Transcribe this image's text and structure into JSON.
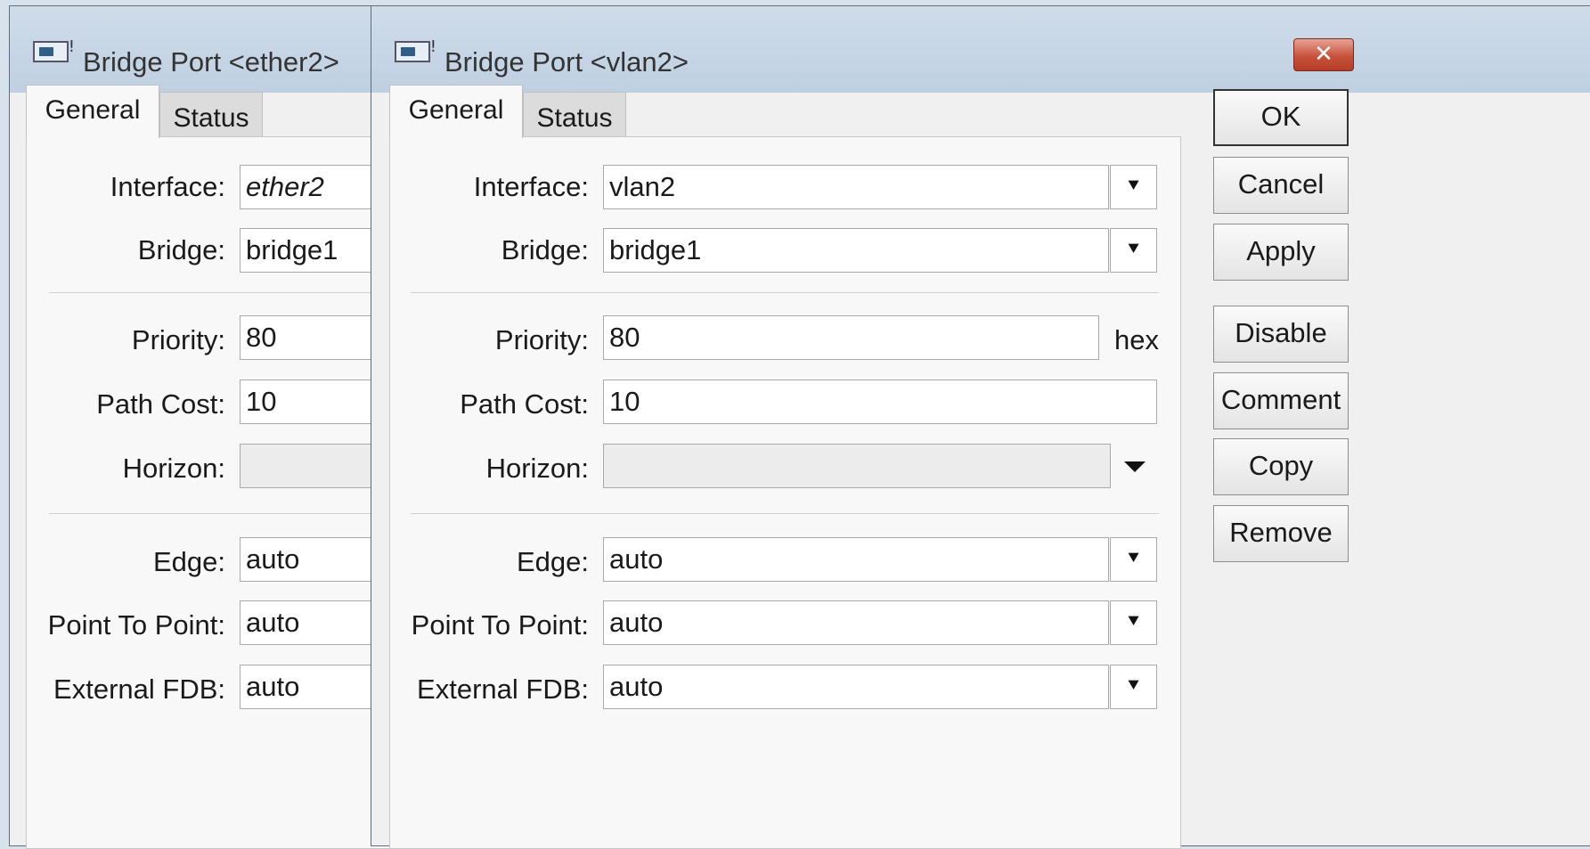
{
  "back_window": {
    "title": "Bridge Port <ether2>",
    "tabs": [
      "General",
      "Status"
    ],
    "fields": {
      "interface": {
        "label": "Interface:",
        "value": "ether2"
      },
      "bridge": {
        "label": "Bridge:",
        "value": "bridge1"
      },
      "priority": {
        "label": "Priority:",
        "value": "80"
      },
      "path_cost": {
        "label": "Path Cost:",
        "value": "10"
      },
      "horizon": {
        "label": "Horizon:",
        "value": ""
      },
      "edge": {
        "label": "Edge:",
        "value": "auto"
      },
      "point_to_point": {
        "label": "Point To Point:",
        "value": "auto"
      },
      "external_fdb": {
        "label": "External FDB:",
        "value": "auto"
      }
    }
  },
  "front_window": {
    "title": "Bridge Port <vlan2>",
    "close_glyph": "✕",
    "tabs": [
      "General",
      "Status"
    ],
    "fields": {
      "interface": {
        "label": "Interface:",
        "value": "vlan2"
      },
      "bridge": {
        "label": "Bridge:",
        "value": "bridge1"
      },
      "priority": {
        "label": "Priority:",
        "value": "80",
        "unit": "hex"
      },
      "path_cost": {
        "label": "Path Cost:",
        "value": "10"
      },
      "horizon": {
        "label": "Horizon:",
        "value": ""
      },
      "edge": {
        "label": "Edge:",
        "value": "auto"
      },
      "point_to_point": {
        "label": "Point To Point:",
        "value": "auto"
      },
      "external_fdb": {
        "label": "External FDB:",
        "value": "auto"
      }
    },
    "dropdown_glyph": "⯆",
    "buttons": {
      "ok": "OK",
      "cancel": "Cancel",
      "apply": "Apply",
      "disable": "Disable",
      "comment": "Comment",
      "copy": "Copy",
      "remove": "Remove"
    }
  },
  "colors": {
    "titlebar": "#c5d5e6",
    "close_button": "#c6523c",
    "window_bg": "#f0f0f0"
  }
}
